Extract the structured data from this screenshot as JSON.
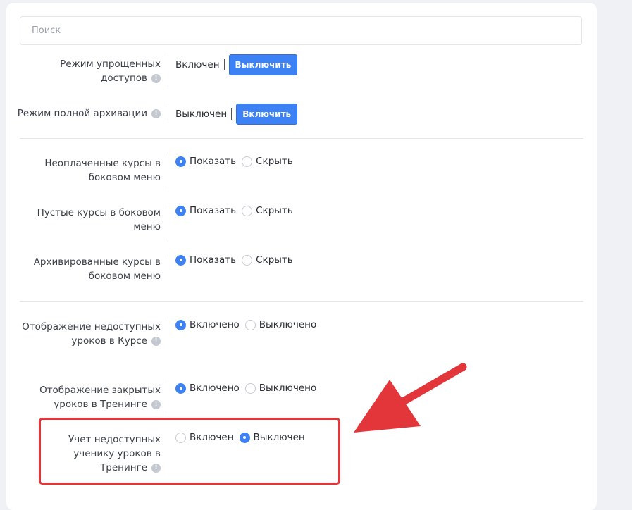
{
  "search": {
    "placeholder": "Поиск"
  },
  "modes": [
    {
      "label": "Режим упрощенных доступов",
      "status": "Включен",
      "button": "Выключить"
    },
    {
      "label": "Режим полной архивации",
      "status": "Выключен",
      "button": "Включить"
    }
  ],
  "menu_settings": [
    {
      "label": "Неоплаченные курсы в боковом меню",
      "options": [
        "Показать",
        "Скрыть"
      ],
      "selected": "Показать"
    },
    {
      "label": "Пустые курсы в боковом меню",
      "options": [
        "Показать",
        "Скрыть"
      ],
      "selected": "Показать"
    },
    {
      "label": "Архивированные курсы в боковом меню",
      "options": [
        "Показать",
        "Скрыть"
      ],
      "selected": "Показать"
    }
  ],
  "lesson_settings": [
    {
      "label": "Отображение недоступных уроков в Курсе",
      "options": [
        "Включено",
        "Выключено"
      ],
      "selected": "Включено"
    },
    {
      "label": "Отображение закрытых уроков в Тренинге",
      "options": [
        "Включено",
        "Выключено"
      ],
      "selected": "Включено"
    },
    {
      "label": "Учет недоступных ученику уроков в Тренинге",
      "options": [
        "Включен",
        "Выключен"
      ],
      "selected": "Выключен"
    }
  ],
  "colors": {
    "accent": "#3d82f5",
    "highlight": "#e2363a"
  },
  "icons": {
    "info": "info-icon",
    "arrow": "red-arrow-annotation"
  }
}
